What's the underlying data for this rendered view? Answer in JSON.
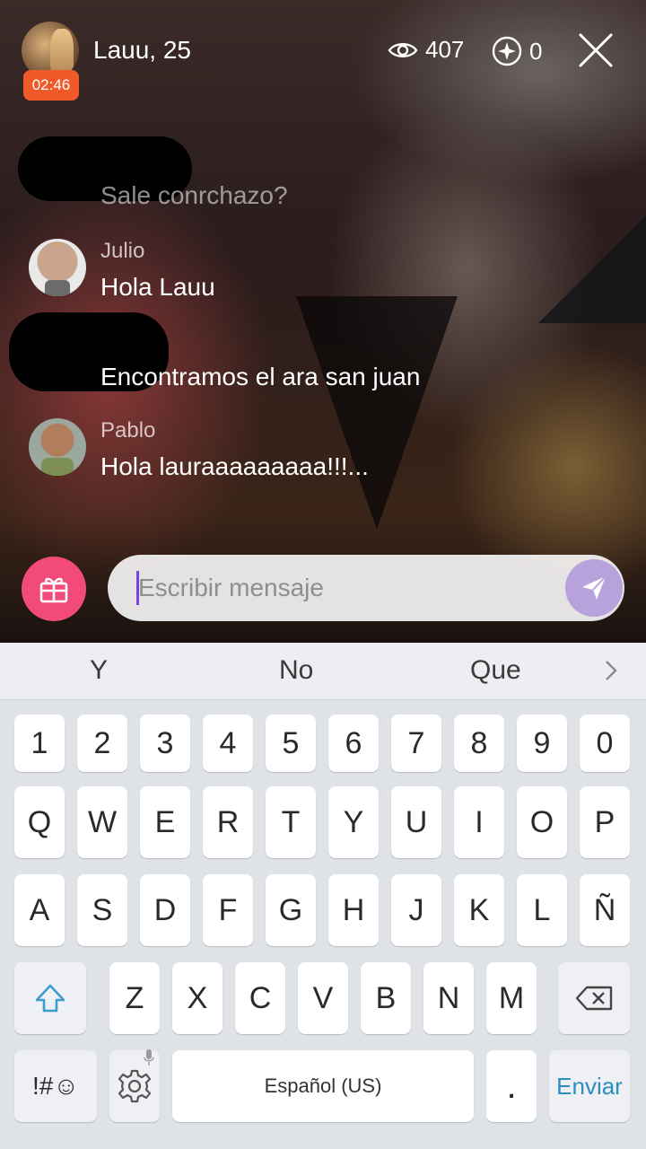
{
  "header": {
    "host_name": "Lauu, 25",
    "live_time": "02:46",
    "viewer_count": "407",
    "star_count": "0"
  },
  "chat": [
    {
      "author": "",
      "text": "Sale conrchazo?",
      "author_redacted": true
    },
    {
      "author": "Julio",
      "text": "Hola Lauu",
      "author_redacted": false
    },
    {
      "author": "",
      "text": "Encontramos el ara san juan",
      "author_redacted": true
    },
    {
      "author": "Pablo",
      "text": "Hola lauraaaaaaaaa!!!...",
      "author_redacted": false
    }
  ],
  "composer": {
    "placeholder": "Escribir mensaje",
    "accent_color": "#7b3fe4",
    "gift_color": "#f24b7a",
    "send_color": "#b7a2dc"
  },
  "keyboard": {
    "suggestions": [
      "Y",
      "No",
      "Que"
    ],
    "number_row": [
      "1",
      "2",
      "3",
      "4",
      "5",
      "6",
      "7",
      "8",
      "9",
      "0"
    ],
    "row1": [
      "Q",
      "W",
      "E",
      "R",
      "T",
      "Y",
      "U",
      "I",
      "O",
      "P"
    ],
    "row2": [
      "A",
      "S",
      "D",
      "F",
      "G",
      "H",
      "J",
      "K",
      "L",
      "Ñ"
    ],
    "row3": [
      "Z",
      "X",
      "C",
      "V",
      "B",
      "N",
      "M"
    ],
    "symbols_label": "!#☺",
    "space_label": "Español (US)",
    "period_label": ".",
    "enter_label": "Enviar"
  },
  "icons": {
    "viewers": "eye-icon",
    "stars": "star-icon",
    "close": "close-icon",
    "gift": "gift-icon",
    "send": "send-icon",
    "shift": "shift-icon",
    "backspace": "backspace-icon",
    "settings": "gear-icon",
    "mic": "mic-icon"
  }
}
